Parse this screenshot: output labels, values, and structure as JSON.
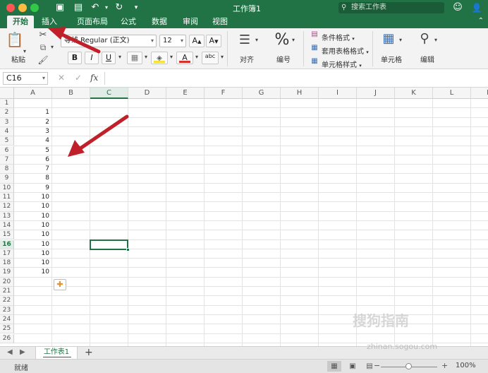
{
  "app": {
    "title": "工作簿1",
    "search_placeholder": "搜索工作表"
  },
  "tabs": [
    "开始",
    "插入",
    "页面布局",
    "公式",
    "数据",
    "审阅",
    "视图"
  ],
  "ribbon": {
    "paste_label": "粘贴",
    "font_name": "等线 Regular (正文)",
    "font_size": "12",
    "bold": "B",
    "italic": "I",
    "underline": "U",
    "grow_font": "A",
    "shrink_font": "A",
    "font_color_glyph": "A",
    "phonetic_glyph": "abc",
    "align_label": "对齐",
    "number_label": "编号",
    "number_glyph": "%",
    "conditional_format": "条件格式",
    "table_format": "套用表格格式",
    "cell_styles": "单元格样式",
    "cells_label": "单元格",
    "edit_label": "编辑"
  },
  "formula_bar": {
    "name_box": "C16",
    "fx": "fx",
    "cancel": "✕",
    "confirm": "✓"
  },
  "columns": [
    "A",
    "B",
    "C",
    "D",
    "E",
    "F",
    "G",
    "H",
    "I",
    "J",
    "K",
    "L",
    "M"
  ],
  "rows": [
    "1",
    "2",
    "3",
    "4",
    "5",
    "6",
    "7",
    "8",
    "9",
    "10",
    "11",
    "12",
    "13",
    "14",
    "15",
    "16",
    "17",
    "18",
    "19",
    "20",
    "21",
    "22",
    "23",
    "24",
    "25",
    "26"
  ],
  "column_a_values": [
    "",
    "1",
    "2",
    "3",
    "4",
    "5",
    "6",
    "7",
    "8",
    "9",
    "10",
    "10",
    "10",
    "10",
    "10",
    "10",
    "10",
    "10",
    "10"
  ],
  "selected_cell": "C16",
  "sheet": {
    "name": "工作表1",
    "add": "+"
  },
  "status": {
    "ready": "就绪",
    "zoom": "100%",
    "zoom_minus": "−",
    "zoom_plus": "+"
  },
  "watermark": {
    "brand": "搜狗指南",
    "url": "zhinan.sogou.com"
  },
  "colors": {
    "accent": "#217346",
    "arrow": "#c0202a"
  }
}
